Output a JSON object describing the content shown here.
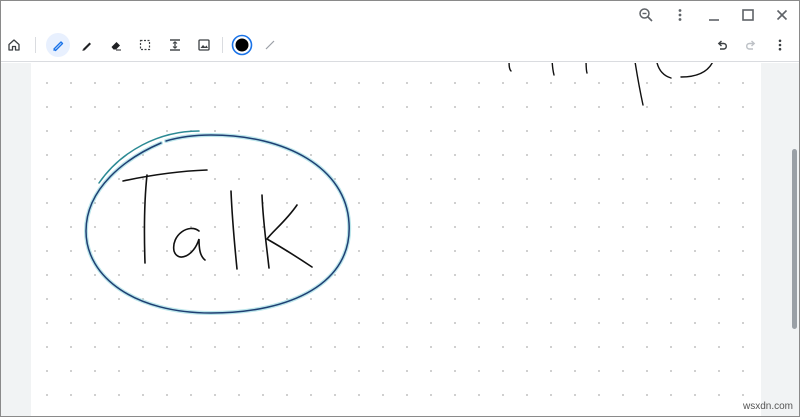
{
  "window_controls": [
    {
      "name": "zoom-icon"
    },
    {
      "name": "more-vert-icon"
    },
    {
      "name": "minimize-icon"
    },
    {
      "name": "maximize-icon"
    },
    {
      "name": "close-icon"
    }
  ],
  "toolbar": {
    "left_tools": [
      "home-icon",
      "highlighter-pen-icon",
      "pen-icon",
      "eraser-icon",
      "lasso-select-icon",
      "insert-space-icon",
      "image-icon"
    ],
    "active_tool": "highlighter-pen-icon",
    "active_color": "#000000",
    "accent_color": "#1a73e8",
    "right_tools": [
      "undo-icon",
      "redo-icon",
      "more-vert-icon"
    ]
  },
  "canvas": {
    "handwritten_word": "Talk",
    "stroke_color": "#1f3f73",
    "glow_color": "#62c4cf"
  },
  "watermark": "wsxdn.com"
}
